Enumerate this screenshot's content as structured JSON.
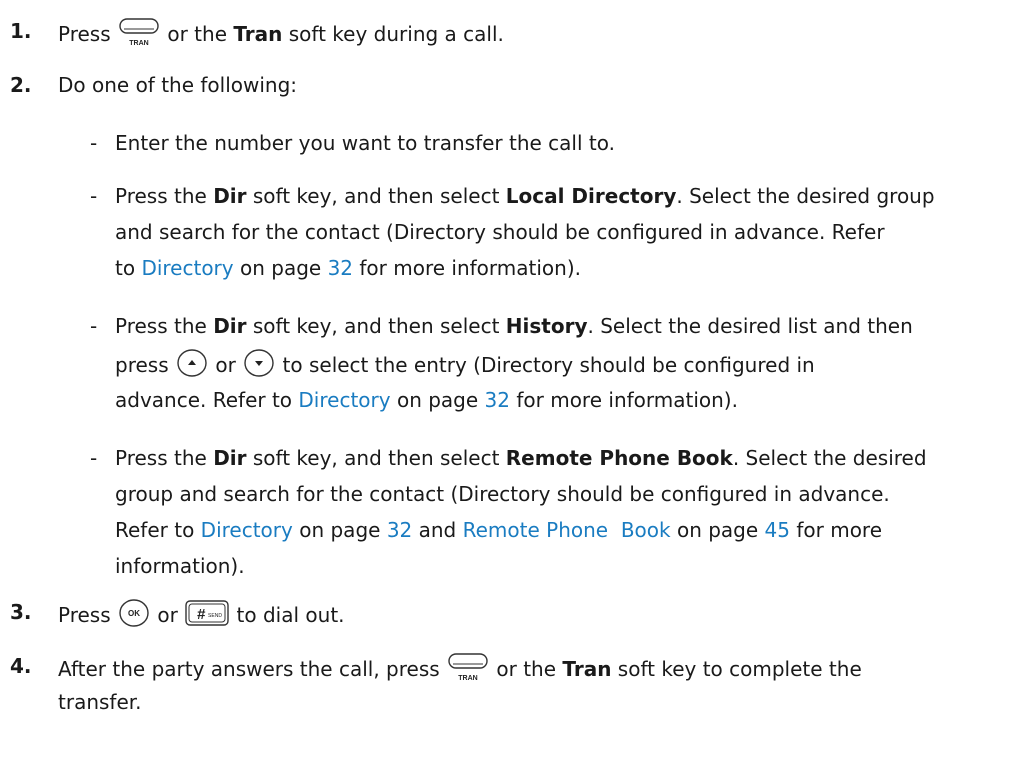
{
  "steps": {
    "s1": {
      "num": "1.",
      "t1": "Press",
      "t2": "or the",
      "key": "Tran",
      "t3": "soft key during a call."
    },
    "s2": {
      "num": "2.",
      "text": "Do one of the following:"
    },
    "b1": {
      "dash": "-",
      "text": "Enter the number you want to transfer the call to."
    },
    "b2": {
      "dash": "-",
      "l1a": "Press the",
      "dir": "Dir",
      "l1b": "soft key, and then select",
      "target": "Local Directory",
      "l1c": ". Select the desired group",
      "l2": "and search for the contact (Directory should be configured in advance. Refer",
      "l3a": "to",
      "link": "Directory",
      "l3b": "on page",
      "page": "32",
      "l3c": "for more information)."
    },
    "b3": {
      "dash": "-",
      "l1a": "Press the",
      "dir": "Dir",
      "l1b": "soft key, and then select",
      "target": "History",
      "l1c": ". Select the desired list and then",
      "l2a": "press",
      "l2b": "or",
      "l2c": "to select the entry (Directory should be configured in",
      "l3a": "advance. Refer to",
      "link": "Directory",
      "l3b": "on page",
      "page": "32",
      "l3c": "for more information)."
    },
    "b4": {
      "dash": "-",
      "l1a": "Press the",
      "dir": "Dir",
      "l1b": "soft key, and then select",
      "target": "Remote Phone Book",
      "l1c": ". Select the desired",
      "l2": "group and search for the contact (Directory should be configured in advance.",
      "l3a": "Refer to",
      "link1": "Directory",
      "l3b": "on page",
      "page1": "32",
      "l3c": "and",
      "link2": "Remote Phone  Book",
      "l3d": "on page",
      "page2": "45",
      "l3e": "for more",
      "l4": "information)."
    },
    "s3": {
      "num": "3.",
      "t1": "Press",
      "t2": "or",
      "t3": "to dial out."
    },
    "s4": {
      "num": "4.",
      "t1": "After the party answers the call, press",
      "t2": "or the",
      "key": "Tran",
      "t3": "soft key to complete the",
      "l2": "transfer."
    }
  },
  "icons": {
    "tran_label": "TRAN",
    "ok_label": "OK",
    "send_hash": "#",
    "send_label": "SEND"
  }
}
